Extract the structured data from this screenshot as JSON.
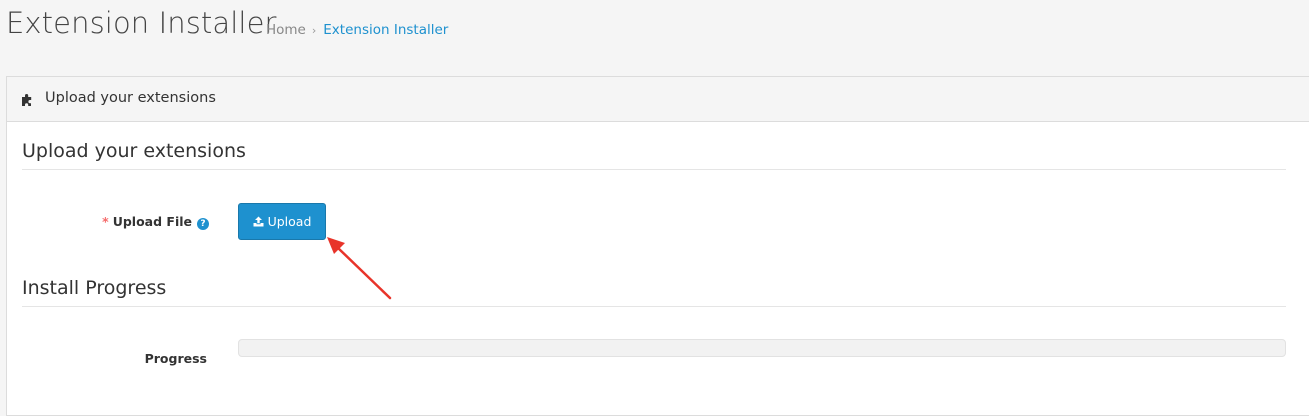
{
  "header": {
    "title": "Extension Installer",
    "breadcrumb": {
      "home": "Home",
      "separator": "›",
      "current": "Extension Installer"
    }
  },
  "panel": {
    "heading_icon": "puzzle-icon",
    "heading": "Upload your extensions",
    "sections": {
      "upload_legend": "Upload your extensions",
      "progress_legend": "Install Progress"
    },
    "upload_field": {
      "required_mark": "*",
      "label": "Upload File",
      "help_icon": "question-circle-icon",
      "button_label": "Upload",
      "button_icon": "upload-icon"
    },
    "progress_field": {
      "label": "Progress",
      "value_percent": 0
    }
  },
  "colors": {
    "accent": "#1e91cf",
    "required": "#f56b6b",
    "annotation_arrow": "#e8342a"
  }
}
